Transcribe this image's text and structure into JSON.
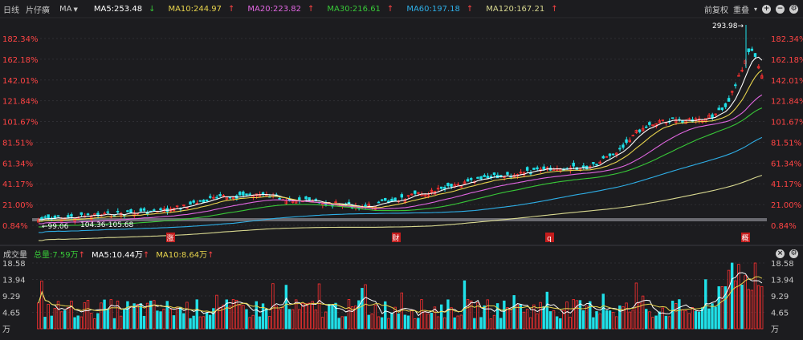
{
  "toolbar": {
    "period_label": "日线",
    "stock_name": "片仔癀",
    "indicator": "MA",
    "ma_values": [
      {
        "label": "MA5:253.48",
        "arrow": "↓",
        "color": "#ffffff"
      },
      {
        "label": "MA10:244.97",
        "arrow": "↑",
        "color": "#e8d44d"
      },
      {
        "label": "MA20:223.82",
        "arrow": "↑",
        "color": "#e066e0"
      },
      {
        "label": "MA30:216.61",
        "arrow": "↑",
        "color": "#38c838"
      },
      {
        "label": "MA60:197.18",
        "arrow": "↑",
        "color": "#2eaee6"
      },
      {
        "label": "MA120:167.21",
        "arrow": "↑",
        "color": "#d8d890"
      }
    ],
    "adjust_label": "前复权",
    "overlay_label": "重叠",
    "icons": [
      "chevron-down-icon",
      "zoom-in-icon",
      "zoom-out-icon",
      "settings-icon"
    ]
  },
  "price_axis": {
    "ticks": [
      "182.34%",
      "162.18%",
      "142.01%",
      "121.84%",
      "101.67%",
      "81.51%",
      "61.34%",
      "41.17%",
      "21.00%",
      "0.84%"
    ]
  },
  "annotations": {
    "high_label": "293.98→",
    "low_label": "←99.06",
    "range_label": "104.36-105.68",
    "event_markers": [
      "涨",
      "财",
      "q",
      "概"
    ]
  },
  "volume_bar": {
    "title": "成交量",
    "total_label": "总量:7.59万",
    "total_arrow": "↑",
    "ma5_label": "MA5:10.44万",
    "ma5_arrow": "↑",
    "ma10_label": "MA10:8.64万",
    "ma10_arrow": "↑",
    "icons": [
      "close-icon",
      "settings-icon"
    ]
  },
  "volume_axis": {
    "ticks": [
      "18.58",
      "13.94",
      "9.29",
      "4.65"
    ],
    "unit": "万"
  },
  "colors": {
    "up": "#ff3030",
    "down": "#20e0e8",
    "text_red": "#ff4444",
    "grid": "#2e2e33"
  }
}
